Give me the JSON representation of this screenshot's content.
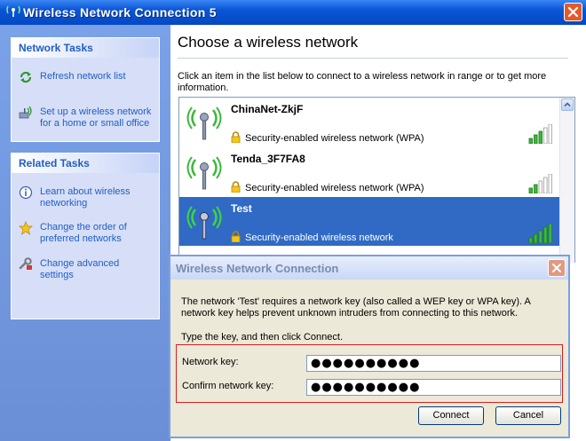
{
  "window": {
    "title": "Wireless Network Connection 5"
  },
  "network_tasks": {
    "heading": "Network Tasks",
    "items": [
      {
        "label": "Refresh network list",
        "icon": "refresh-icon"
      },
      {
        "label": "Set up a wireless network for a home or small office",
        "icon": "wireless-setup-icon"
      }
    ]
  },
  "related_tasks": {
    "heading": "Related Tasks",
    "items": [
      {
        "label": "Learn about wireless networking",
        "icon": "info-icon"
      },
      {
        "label": "Change the order of preferred networks",
        "icon": "star-icon"
      },
      {
        "label": "Change advanced settings",
        "icon": "settings-icon"
      }
    ]
  },
  "main": {
    "heading": "Choose a wireless network",
    "intro": "Click an item in the list below to connect to a wireless network in range or to get more information."
  },
  "networks": [
    {
      "ssid": "ChinaNet-ZkjF",
      "security": "Security-enabled wireless network (WPA)",
      "signal_bars": 3,
      "selected": false
    },
    {
      "ssid": "Tenda_3F7FA8",
      "security": "Security-enabled wireless network (WPA)",
      "signal_bars": 2,
      "selected": false
    },
    {
      "ssid": "Test",
      "security": "Security-enabled wireless network",
      "signal_bars": 5,
      "selected": true
    }
  ],
  "dialog": {
    "title": "Wireless Network Connection",
    "message": "The network 'Test' requires a network key (also called a WEP key or WPA key). A network key helps prevent unknown intruders from connecting to this network.",
    "instruction": "Type the key, and then click Connect.",
    "network_key_label": "Network key:",
    "network_key_value": "●●●●●●●●●●",
    "confirm_key_label": "Confirm network key:",
    "confirm_key_value": "●●●●●●●●●●",
    "connect_label": "Connect",
    "cancel_label": "Cancel"
  },
  "colors": {
    "title_bar": "#0a55d6",
    "task_link": "#215dc6",
    "selection": "#316ac5",
    "highlight_border": "#d81e1e"
  }
}
